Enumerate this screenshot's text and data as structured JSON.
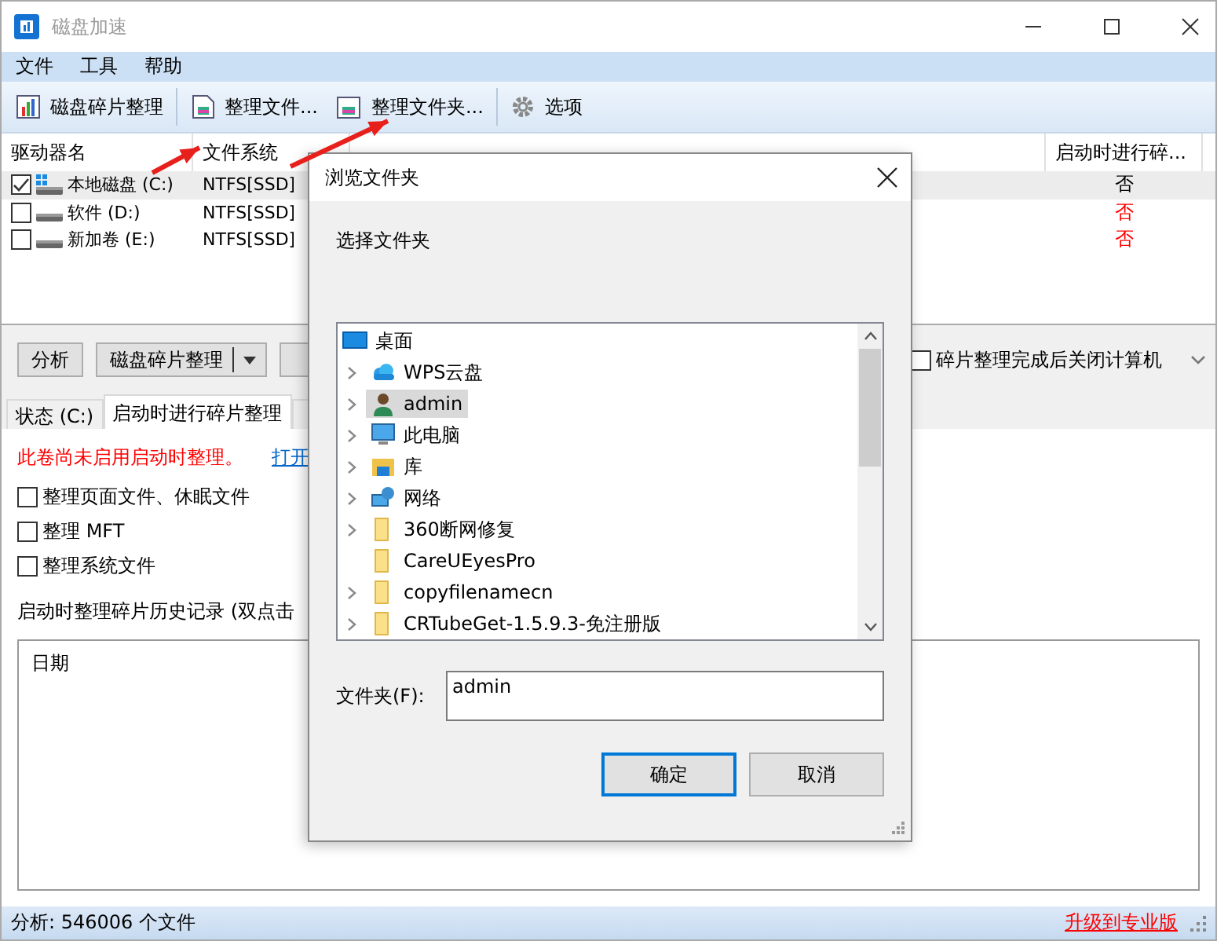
{
  "window": {
    "title": "磁盘加速"
  },
  "menu": [
    "文件",
    "工具",
    "帮助"
  ],
  "toolbar": [
    {
      "label": "磁盘碎片整理",
      "kind": "chart"
    },
    {
      "label": "整理文件...",
      "kind": "file"
    },
    {
      "label": "整理文件夹...",
      "kind": "folder"
    },
    {
      "label": "选项",
      "kind": "gear"
    }
  ],
  "drive_table": {
    "columns": [
      "驱动器名",
      "文件系统",
      "启动时进行碎..."
    ],
    "rows": [
      {
        "name": "本地磁盘 (C:)",
        "checked": true,
        "selected": true,
        "kind": "system",
        "fs": "NTFS[SSD]",
        "boot": "否",
        "color": "#000000"
      },
      {
        "name": "软件 (D:)",
        "checked": false,
        "selected": false,
        "kind": "disk",
        "fs": "NTFS[SSD]",
        "boot": "否",
        "color": "#ff0000"
      },
      {
        "name": "新加卷 (E:)",
        "checked": false,
        "selected": false,
        "kind": "disk",
        "fs": "NTFS[SSD]",
        "boot": "否",
        "color": "#ff0000"
      }
    ]
  },
  "actions": {
    "analyze": "分析",
    "defrag": "磁盘碎片整理",
    "shutdown": {
      "label": "碎片整理完成后关闭计算机",
      "checked": false
    }
  },
  "tabs": [
    {
      "label": "状态 (C:)",
      "selected": false
    },
    {
      "label": "启动时进行碎片整理",
      "selected": true
    }
  ],
  "boot_panel": {
    "notice": "此卷尚未启用启动时整理。",
    "link": "打开",
    "options": [
      {
        "label": "整理页面文件、休眠文件",
        "checked": false
      },
      {
        "label": "整理 MFT",
        "checked": false
      },
      {
        "label": "整理系统文件",
        "checked": false
      }
    ],
    "history_label": "启动时整理碎片历史记录 (双点击",
    "history_columns": [
      "日期"
    ]
  },
  "status_bar": {
    "text": "分析: 546006 个文件",
    "link": "升级到专业版"
  },
  "dialog": {
    "title": "浏览文件夹",
    "prompt": "选择文件夹",
    "tree": [
      {
        "label": "桌面",
        "kind": "desktop",
        "selected": false,
        "children": [
          {
            "label": "WPS云盘",
            "kind": "cloud",
            "has_children": true,
            "selected": false
          },
          {
            "label": "admin",
            "kind": "user",
            "has_children": true,
            "selected": true
          },
          {
            "label": "此电脑",
            "kind": "computer",
            "has_children": true,
            "selected": false
          },
          {
            "label": "库",
            "kind": "library",
            "has_children": true,
            "selected": false
          },
          {
            "label": "网络",
            "kind": "network",
            "has_children": true,
            "selected": false
          },
          {
            "label": "360断网修复",
            "kind": "folder",
            "has_children": true,
            "selected": false
          },
          {
            "label": "CareUEyesPro",
            "kind": "folder",
            "has_children": false,
            "selected": false
          },
          {
            "label": "copyfilenamecn",
            "kind": "folder",
            "has_children": true,
            "selected": false
          },
          {
            "label": "CRTubeGet-1.5.9.3-免注册版",
            "kind": "folder",
            "has_children": true,
            "selected": false
          }
        ]
      }
    ],
    "folder_label": "文件夹(F):",
    "folder_value": "admin",
    "ok": "确定",
    "cancel": "取消"
  }
}
